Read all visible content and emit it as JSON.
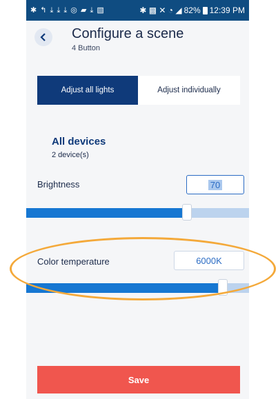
{
  "status_bar": {
    "left_icons": "✱ ↰ ⤓ ⤓ ⤓ ◎ ▰ ⤓ ▧",
    "right_icons": "✱ ▩ ✕ ◔ ◢",
    "battery": "82%",
    "time": "12:39 PM"
  },
  "header": {
    "title": "Configure a scene",
    "subtitle": "4 Button",
    "back_icon": "chevron-left-icon"
  },
  "segmented": {
    "active_label": "Adjust all lights",
    "inactive_label": "Adjust individually"
  },
  "devices": {
    "title": "All devices",
    "count": "2 device(s)"
  },
  "brightness": {
    "label": "Brightness",
    "value": "70",
    "slider_level": 0.7
  },
  "color_temperature": {
    "label": "Color temperature",
    "value": "6000K",
    "slider_level": 0.86
  },
  "save": {
    "label": "Save"
  },
  "colors": {
    "status_bar": "#0f4c81",
    "accent_dark": "#0f3a7a",
    "accent": "#1677d2",
    "save": "#f0564e",
    "annotation": "#f4a93a"
  }
}
